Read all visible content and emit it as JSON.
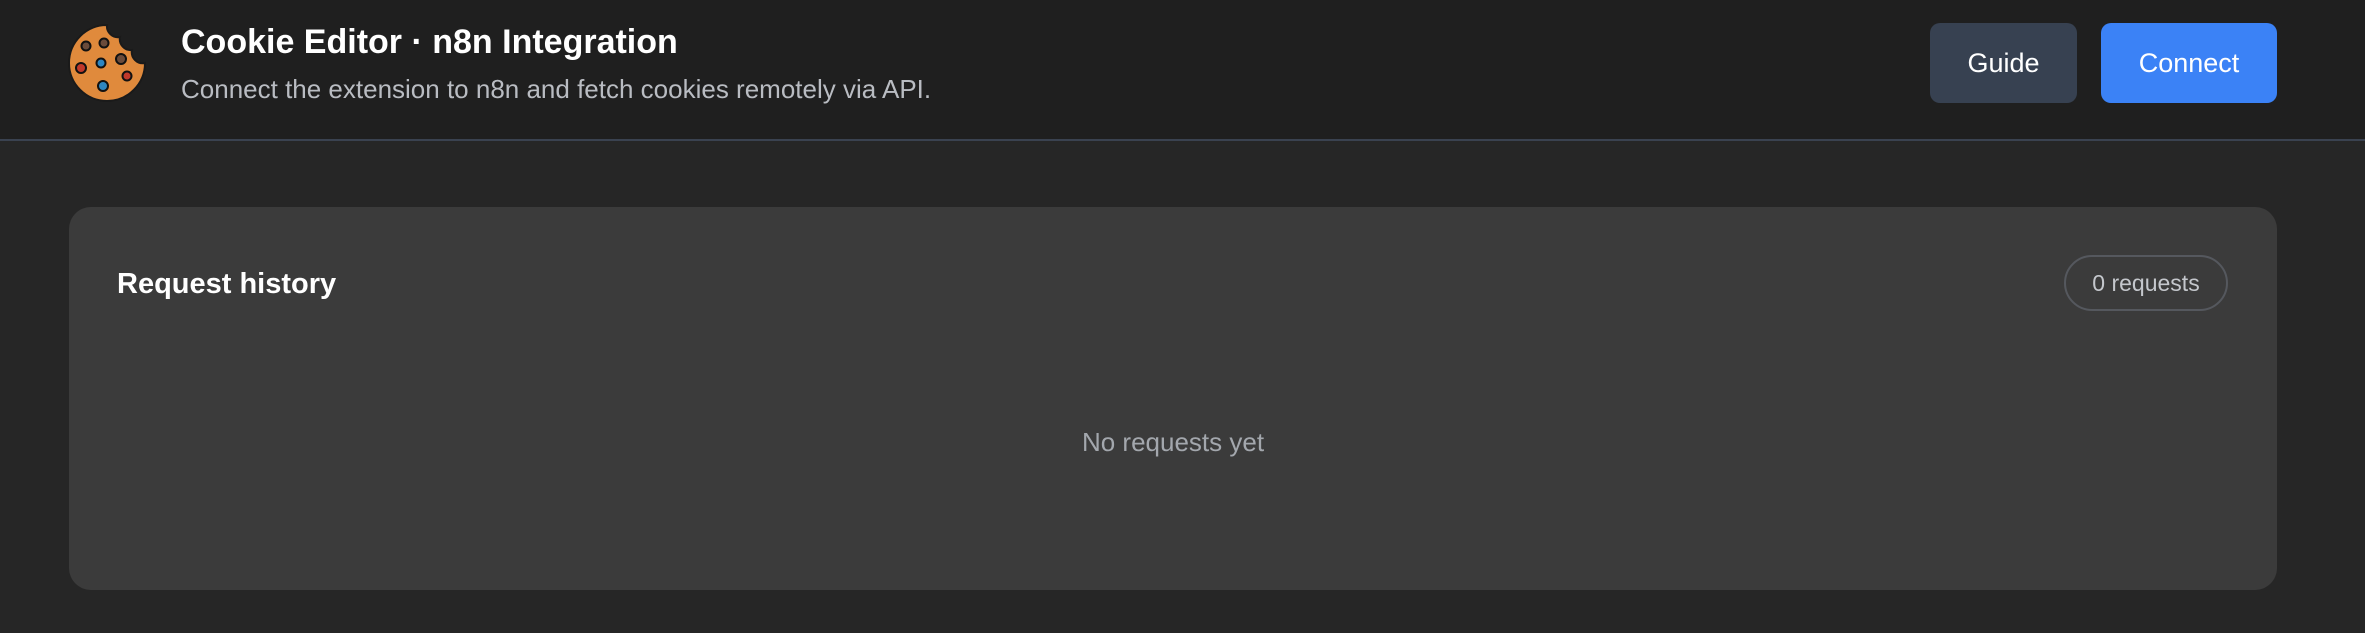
{
  "header": {
    "title": "Cookie Editor · n8n Integration",
    "subtitle": "Connect the extension to n8n and fetch cookies remotely via API.",
    "logo_icon": "cookie-icon",
    "buttons": {
      "guide_label": "Guide",
      "connect_label": "Connect"
    }
  },
  "history": {
    "title": "Request history",
    "count_label": "0 requests",
    "empty_text": "No requests yet"
  },
  "colors": {
    "page_background": "#262626",
    "header_background": "#1f1f1f",
    "panel_background": "#3b3b3b",
    "accent": "#3b82f6",
    "secondary_button": "#374151",
    "cookie": "#e08a3c"
  }
}
